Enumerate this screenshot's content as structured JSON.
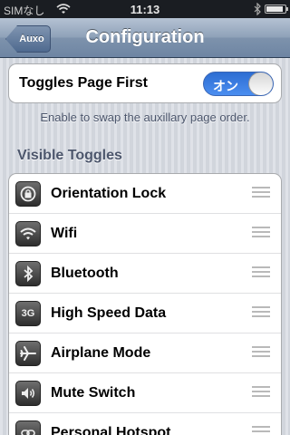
{
  "status_bar": {
    "carrier": "SIMなし",
    "time": "11:13"
  },
  "nav": {
    "back_label": "Auxo",
    "title": "Configuration"
  },
  "toggles_page_first": {
    "label": "Toggles Page First",
    "switch_text": "オン",
    "on": true
  },
  "footer_note": "Enable to swap the auxillary page order.",
  "section_header": "Visible Toggles",
  "toggles": [
    {
      "label": "Orientation Lock",
      "icon": "orientation-lock-icon"
    },
    {
      "label": "Wifi",
      "icon": "wifi-icon"
    },
    {
      "label": "Bluetooth",
      "icon": "bluetooth-icon"
    },
    {
      "label": "High Speed Data",
      "icon": "3g-icon",
      "icon_text": "3G"
    },
    {
      "label": "Airplane Mode",
      "icon": "airplane-icon"
    },
    {
      "label": "Mute Switch",
      "icon": "speaker-icon"
    },
    {
      "label": "Personal Hotspot",
      "icon": "hotspot-icon"
    }
  ]
}
